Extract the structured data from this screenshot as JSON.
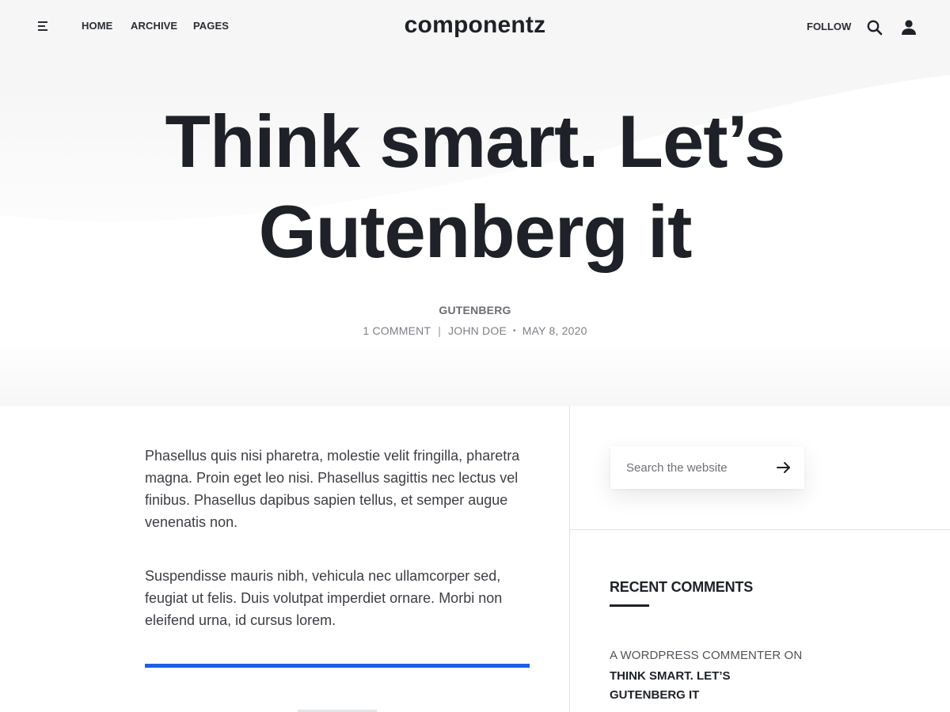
{
  "header": {
    "menu_icon": "hamburger-menu-icon",
    "nav": [
      {
        "label": "HOME"
      },
      {
        "label": "ARCHIVE"
      },
      {
        "label": "PAGES"
      }
    ],
    "site_title": "componentz",
    "follow_label": "FOLLOW",
    "search_icon": "search-icon",
    "user_icon": "user-icon"
  },
  "post": {
    "title_line1": "Think smart. Let’s",
    "title_line2": "Gutenberg it",
    "category": "GUTENBERG",
    "comments": "1 COMMENT",
    "separator": "|",
    "author": "JOHN DOE",
    "bullet": "•",
    "date": "MAY 8, 2020",
    "paragraphs": [
      "Phasellus quis nisi pharetra, molestie velit fringilla, pharetra magna. Proin eget leo nisi. Phasellus sagittis nec lectus vel finibus. Phasellus dapibus sapien tellus, et semper augue venenatis non.",
      "Suspendisse mauris nibh, vehicula nec ullamcorper sed, feugiat ut felis. Duis volutpat imperdiet ornare. Morbi non eleifend urna, id cursus lorem."
    ]
  },
  "sidebar": {
    "search": {
      "placeholder": "Search the website",
      "value": "",
      "submit_icon": "arrow-right-icon"
    },
    "recent_comments": {
      "title": "RECENT COMMENTS",
      "items": [
        {
          "author": "A WORDPRESS COMMENTER ON",
          "post": "THINK SMART. LET’S GUTENBERG IT"
        }
      ]
    }
  },
  "colors": {
    "accent": "#1a5fe6",
    "text": "#1e2127",
    "hero_background": "#f6f6f7"
  }
}
